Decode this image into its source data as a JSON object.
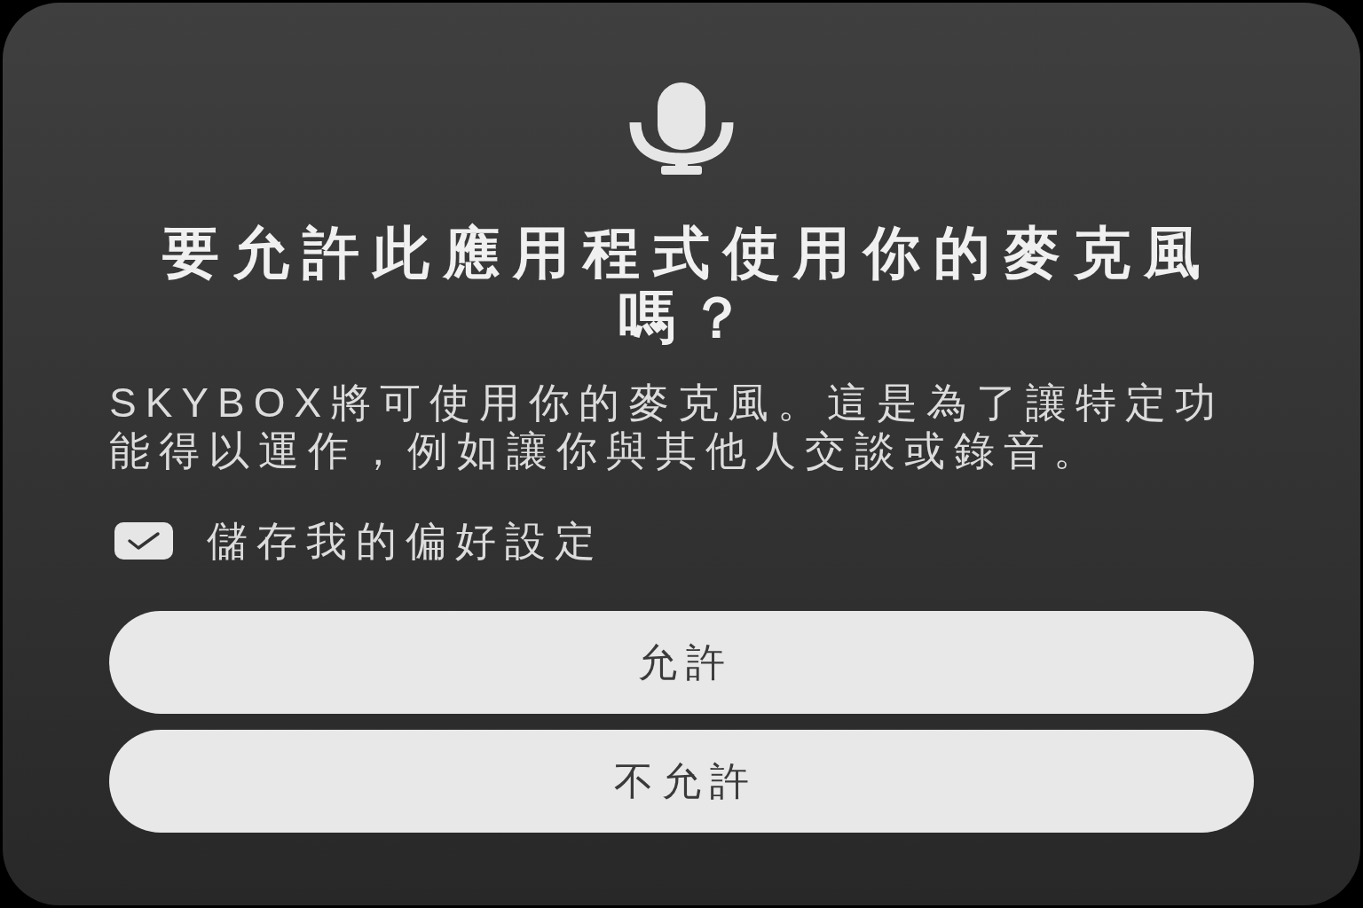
{
  "dialog": {
    "title": "要允許此應用程式使用你的麥克風嗎？",
    "message": "SKYBOX將可使用你的麥克風。這是為了讓特定功能得以運作，例如讓你與其他人交談或錄音。",
    "remember_choice": {
      "label": "儲存我的偏好設定",
      "checked": true
    },
    "buttons": [
      {
        "label": "允許"
      },
      {
        "label": "不允許"
      }
    ]
  }
}
